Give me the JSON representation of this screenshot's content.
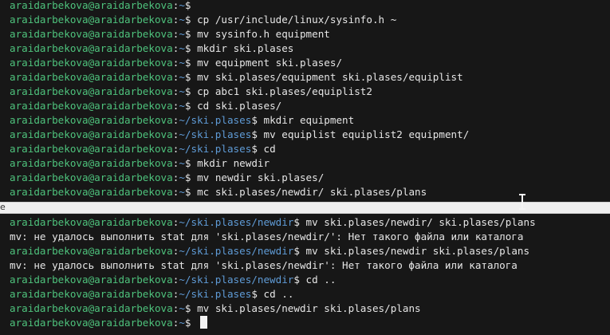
{
  "terminal": {
    "top_lines": [
      {
        "user": "araidarbekova@araidarbekova",
        "path": "~",
        "cmd": ""
      },
      {
        "user": "araidarbekova@araidarbekova",
        "path": "~",
        "cmd": "cp /usr/include/linux/sysinfo.h ~"
      },
      {
        "user": "araidarbekova@araidarbekova",
        "path": "~",
        "cmd": "mv sysinfo.h equipment"
      },
      {
        "user": "araidarbekova@araidarbekova",
        "path": "~",
        "cmd": "mkdir ski.plases"
      },
      {
        "user": "araidarbekova@araidarbekova",
        "path": "~",
        "cmd": "mv equipment ski.plases/"
      },
      {
        "user": "araidarbekova@araidarbekova",
        "path": "~",
        "cmd": "mv ski.plases/equipment ski.plases/equiplist"
      },
      {
        "user": "araidarbekova@araidarbekova",
        "path": "~",
        "cmd": "cp abc1 ski.plases/equiplist2"
      },
      {
        "user": "araidarbekova@araidarbekova",
        "path": "~",
        "cmd": "cd ski.plases/"
      },
      {
        "user": "araidarbekova@araidarbekova",
        "path": "~/ski.plases",
        "cmd": "mkdir equipment"
      },
      {
        "user": "araidarbekova@araidarbekova",
        "path": "~/ski.plases",
        "cmd": "mv equiplist equiplist2 equipment/"
      },
      {
        "user": "araidarbekova@araidarbekova",
        "path": "~/ski.plases",
        "cmd": "cd"
      },
      {
        "user": "araidarbekova@araidarbekova",
        "path": "~",
        "cmd": "mkdir newdir"
      },
      {
        "user": "araidarbekova@araidarbekova",
        "path": "~",
        "cmd": "mv newdir ski.plases/"
      },
      {
        "user": "araidarbekova@araidarbekova",
        "path": "~",
        "cmd": "mc ski.plases/newdir/ ski.plases/plans"
      }
    ],
    "gap_char": "e",
    "bottom_lines": [
      {
        "type": "prompt",
        "user": "araidarbekova@araidarbekova",
        "path": "~/ski.plases/newdir",
        "cmd": "mv ski.plases/newdir/ ski.plases/plans"
      },
      {
        "type": "output",
        "text": "mv: не удалось выполнить stat для 'ski.plases/newdir/': Нет такого файла или каталога"
      },
      {
        "type": "prompt",
        "user": "araidarbekova@araidarbekova",
        "path": "~/ski.plases/newdir",
        "cmd": "mv ski.plases/newdir ski.plases/plans"
      },
      {
        "type": "output",
        "text": "mv: не удалось выполнить stat для 'ski.plases/newdir': Нет такого файла или каталога"
      },
      {
        "type": "prompt",
        "user": "araidarbekova@araidarbekova",
        "path": "~/ski.plases/newdir",
        "cmd": "cd .."
      },
      {
        "type": "prompt",
        "user": "araidarbekova@araidarbekova",
        "path": "~/ski.plases",
        "cmd": "cd .."
      },
      {
        "type": "prompt",
        "user": "araidarbekova@araidarbekova",
        "path": "~",
        "cmd": "mv ski.plases/newdir ski.plases/plans"
      },
      {
        "type": "prompt",
        "user": "araidarbekova@araidarbekova",
        "path": "~",
        "cmd": "",
        "cursor": true
      }
    ],
    "colors": {
      "background": "#171717",
      "user": "#4ec27c",
      "path": "#5f9bd6",
      "text": "#e8e8e8"
    },
    "icons": [
      "text-cursor-icon",
      "block-cursor-icon"
    ]
  }
}
